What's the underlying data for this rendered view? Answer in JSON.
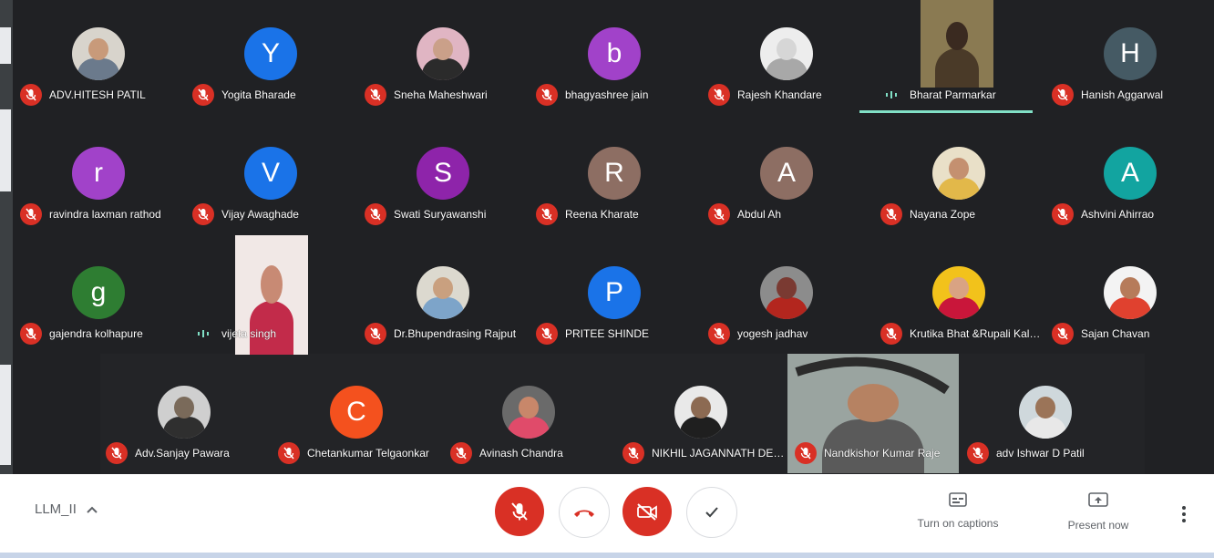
{
  "participants": [
    {
      "name": "ADV.HITESH PATIL",
      "type": "photo",
      "skin": "#c89a7a",
      "shirt": "#6b7a8c",
      "bg": "#d8d4cc"
    },
    {
      "name": "Yogita Bharade",
      "type": "letter",
      "letter": "Y",
      "color": "#1a73e8"
    },
    {
      "name": "Sneha Maheshwari",
      "type": "photo",
      "skin": "#caa089",
      "shirt": "#2b2b2b",
      "bg": "#e0b5c3"
    },
    {
      "name": "bhagyashree jain",
      "type": "letter",
      "letter": "b",
      "color": "#a142c9"
    },
    {
      "name": "Rajesh Khandare",
      "type": "photo",
      "skin": "#d6d6d6",
      "shirt": "#a8a8a8",
      "bg": "#ededed"
    },
    {
      "name": "Bharat Parmarkar",
      "type": "video"
    },
    {
      "name": "Hanish Aggarwal",
      "type": "letter",
      "letter": "H",
      "color": "#455a64"
    },
    {
      "name": "ravindra laxman rathod",
      "type": "letter",
      "letter": "r",
      "color": "#a142c9"
    },
    {
      "name": "Vijay Awaghade",
      "type": "letter",
      "letter": "V",
      "color": "#1a73e8"
    },
    {
      "name": "Swati Suryawanshi",
      "type": "letter",
      "letter": "S",
      "color": "#8e24aa"
    },
    {
      "name": "Reena Kharate",
      "type": "letter",
      "letter": "R",
      "color": "#8d6e63"
    },
    {
      "name": "Abdul Ah",
      "type": "letter",
      "letter": "A",
      "color": "#8d6e63"
    },
    {
      "name": "Nayana Zope",
      "type": "photo",
      "skin": "#c49070",
      "shirt": "#e2b84a",
      "bg": "#e9e0c8"
    },
    {
      "name": "Ashvini Ahirrao",
      "type": "letter",
      "letter": "A",
      "color": "#12a4a0"
    },
    {
      "name": "gajendra kolhapure",
      "type": "letter",
      "letter": "g",
      "color": "#2e7d32"
    },
    {
      "name": "vijeta singh",
      "type": "video"
    },
    {
      "name": "Dr.Bhupendrasing Rajput",
      "type": "photo",
      "skin": "#c9a07f",
      "shirt": "#7da4c9",
      "bg": "#dcd9cf"
    },
    {
      "name": "PRITEE SHINDE",
      "type": "letter",
      "letter": "P",
      "color": "#1a73e8"
    },
    {
      "name": "yogesh jadhav",
      "type": "photo",
      "skin": "#7a3a32",
      "shirt": "#b3261e",
      "bg": "#8c8c8c"
    },
    {
      "name": "Krutika Bhat &Rupali Kalamkar",
      "type": "photo",
      "skin": "#d9a383",
      "shirt": "#c9163a",
      "bg": "#f2c21b"
    },
    {
      "name": "Sajan Chavan",
      "type": "photo",
      "skin": "#b67b5a",
      "shirt": "#e0412f",
      "bg": "#f3f3f3"
    },
    {
      "name": "Adv.Sanjay Pawara",
      "type": "photo",
      "skin": "#7a6a5a",
      "shirt": "#2f2f2f",
      "bg": "#cfcfcf"
    },
    {
      "name": "Chetankumar Telgaonkar",
      "type": "letter",
      "letter": "C",
      "color": "#f4511e"
    },
    {
      "name": "Avinash Chandra",
      "type": "photo",
      "skin": "#c8876a",
      "shirt": "#e04b6a",
      "bg": "#6a6a6a"
    },
    {
      "name": "NIKHIL JAGANNATH DESHMUKH",
      "type": "photo",
      "skin": "#8c6a52",
      "shirt": "#1f1f1f",
      "bg": "#e9e9e9"
    },
    {
      "name": "Nandkishor Kumar Raje",
      "type": "video"
    },
    {
      "name": "adv Ishwar D Patil",
      "type": "photo",
      "skin": "#9b7458",
      "shirt": "#e8e8e8",
      "bg": "#cfd8dc"
    }
  ],
  "toolbar": {
    "meeting_name": "LLM_II",
    "captions_label": "Turn on captions",
    "present_label": "Present now"
  },
  "colors": {
    "danger": "#d93025",
    "accent": "#81e0c6",
    "bg": "#202124"
  }
}
